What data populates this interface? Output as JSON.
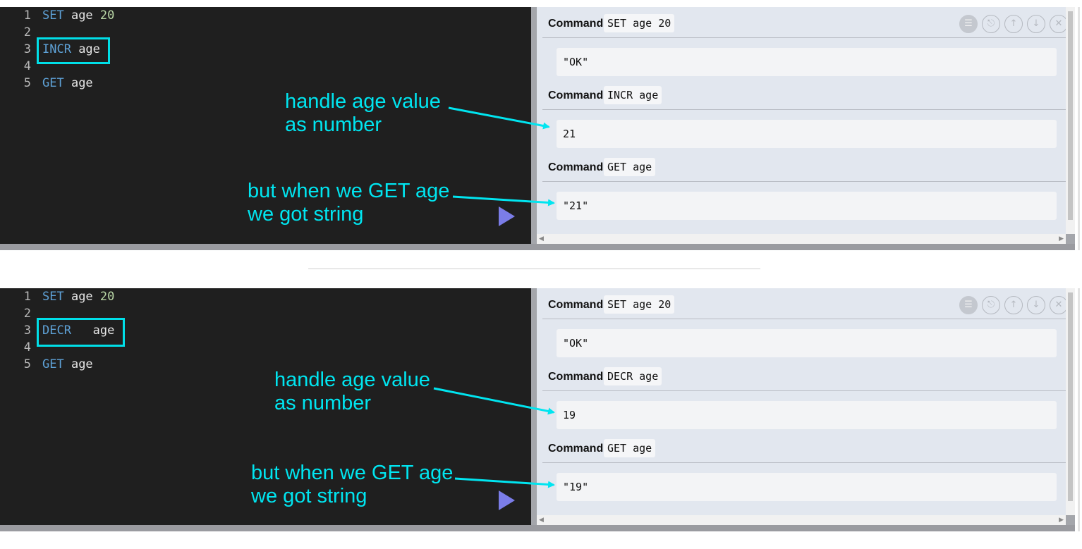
{
  "top": {
    "editor": {
      "lines": [
        {
          "n": "1",
          "kw": "SET",
          "rest": " age ",
          "num": "20"
        },
        {
          "n": "2",
          "kw": "",
          "rest": "",
          "num": ""
        },
        {
          "n": "3",
          "kw": "INCR",
          "rest": " age",
          "num": ""
        },
        {
          "n": "4",
          "kw": "",
          "rest": "",
          "num": ""
        },
        {
          "n": "5",
          "kw": "GET",
          "rest": " age",
          "num": ""
        }
      ]
    },
    "annotations": [
      {
        "text": "handle age value\nas number"
      },
      {
        "text": "but when we GET age\nwe got string"
      }
    ],
    "results": [
      {
        "label": "Command",
        "command": "SET age 20",
        "output": "\"OK\""
      },
      {
        "label": "Command",
        "command": "INCR age",
        "output": "21"
      },
      {
        "label": "Command",
        "command": "GET age",
        "output": "\"21\""
      }
    ]
  },
  "bottom": {
    "editor": {
      "lines": [
        {
          "n": "1",
          "kw": "SET",
          "rest": " age ",
          "num": "20"
        },
        {
          "n": "2",
          "kw": "",
          "rest": "",
          "num": ""
        },
        {
          "n": "3",
          "kw": "DECR",
          "rest": "   age",
          "num": ""
        },
        {
          "n": "4",
          "kw": "",
          "rest": "",
          "num": ""
        },
        {
          "n": "5",
          "kw": "GET",
          "rest": " age",
          "num": ""
        }
      ]
    },
    "annotations": [
      {
        "text": "handle age value\nas number"
      },
      {
        "text": "but when we GET age\nwe got string"
      }
    ],
    "results": [
      {
        "label": "Command",
        "command": "SET age 20",
        "output": "\"OK\""
      },
      {
        "label": "Command",
        "command": "DECR age",
        "output": "19"
      },
      {
        "label": "Command",
        "command": "GET age",
        "output": "\"19\""
      }
    ]
  },
  "toolbar_icons": [
    "list-icon",
    "paint-roller-icon",
    "arrow-up-icon",
    "arrow-down-icon",
    "close-icon"
  ],
  "colors": {
    "editor_bg": "#1f1f1f",
    "keyword": "#5ea1d6",
    "annotation": "#00e5f0",
    "play": "#7b7de8",
    "results_bg": "#e2e7ef"
  }
}
